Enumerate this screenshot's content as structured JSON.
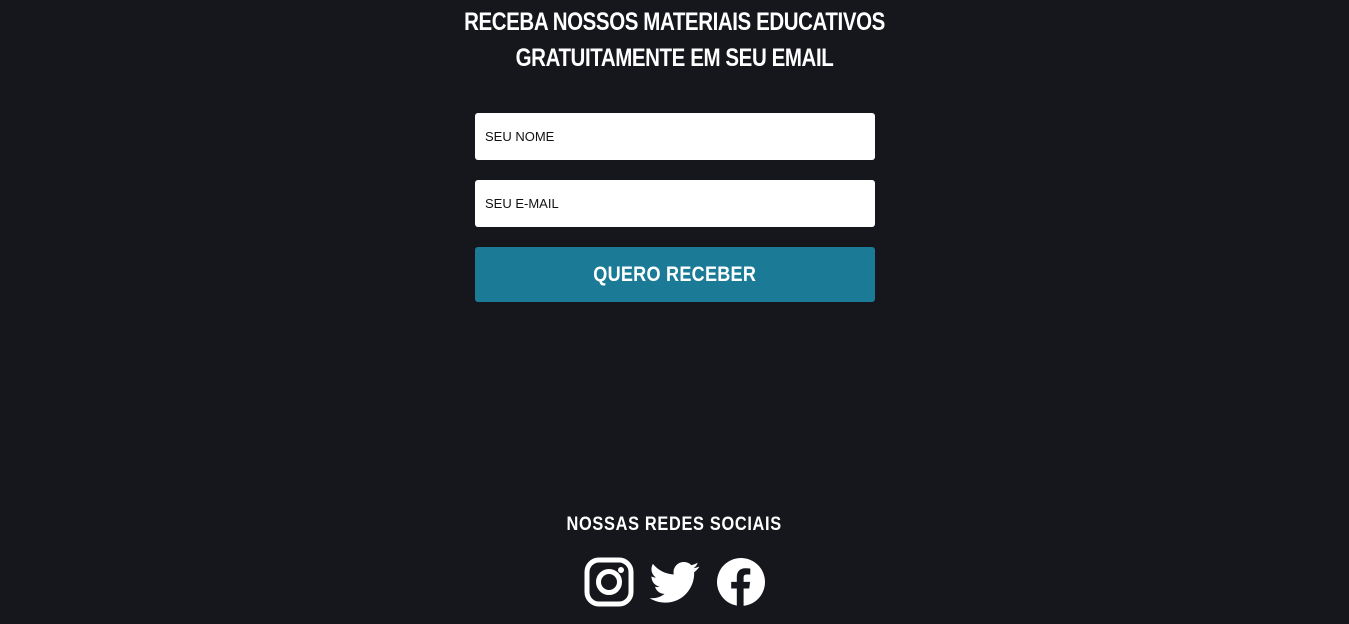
{
  "newsletter": {
    "headline_line1": "RECEBA NOSSOS MATERIAIS EDUCATIVOS",
    "headline_line2": "GRATUITAMENTE EM SEU EMAIL",
    "name_placeholder": "SEU NOME",
    "name_value": "",
    "email_placeholder": "SEU E-MAIL",
    "email_value": "",
    "submit_label": "QUERO RECEBER"
  },
  "social": {
    "title": "NOSSAS REDES SOCIAIS",
    "icons": [
      "instagram-icon",
      "twitter-icon",
      "facebook-icon"
    ]
  },
  "colors": {
    "background": "#16171c",
    "accent": "#1b7b97",
    "text": "#ffffff"
  }
}
